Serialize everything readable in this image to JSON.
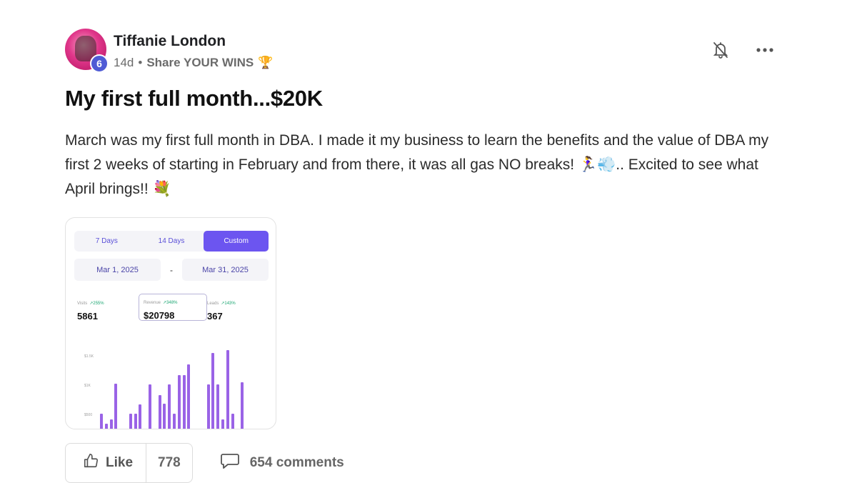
{
  "post": {
    "author": "Tiffanie London",
    "level": "6",
    "age": "14d",
    "separator": "•",
    "category": "Share YOUR WINS",
    "category_emoji": "🏆",
    "title": "My first full month...$20K",
    "body": "March was my first full month in DBA. I made it my business to learn the benefits and the value of DBA my first 2 weeks of starting in February and from there, it was all gas NO breaks! 🏃‍♀️💨.. Excited to see what April brings!! 💐",
    "icons": [
      "bell-off-icon",
      "more-options-icon"
    ]
  },
  "dashboard": {
    "tabs": [
      {
        "label": "7 Days",
        "active": false
      },
      {
        "label": "14 Days",
        "active": false
      },
      {
        "label": "Custom",
        "active": true
      }
    ],
    "date_start": "Mar 1, 2025",
    "date_sep": "-",
    "date_end": "Mar 31, 2025",
    "stats": [
      {
        "label": "Visits",
        "change": "↗255%",
        "value": "5861"
      },
      {
        "label": "Revenue",
        "change": "↗348%",
        "value": "$20798"
      },
      {
        "label": "Leads",
        "change": "↗143%",
        "value": "367"
      }
    ],
    "y_labels": [
      "$1.5K",
      "$1K",
      "$500"
    ],
    "bar_values": [
      270,
      90,
      160,
      800,
      0,
      0,
      270,
      270,
      430,
      0,
      790,
      0,
      600,
      450,
      790,
      270,
      950,
      950,
      1150,
      0,
      0,
      0,
      790,
      1350,
      790,
      160,
      1400,
      270,
      0,
      830
    ],
    "bar_max": 1500,
    "accent": "#6c55f0"
  },
  "actions": {
    "like_label": "Like",
    "like_count": "778",
    "comments_label": "654 comments"
  }
}
